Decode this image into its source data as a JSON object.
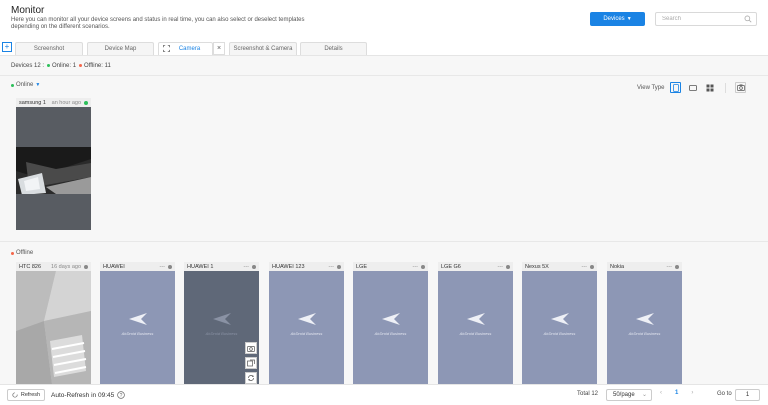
{
  "header": {
    "title": "Monitor",
    "description": "Here you can monitor all your device screens and status in real time, you can also select or deselect templates depending on the different scenarios.",
    "devices_button": "Devices",
    "search_placeholder": "Search"
  },
  "tabs": [
    {
      "label": "Screenshot",
      "active": false
    },
    {
      "label": "Device Map",
      "active": false
    },
    {
      "label": "Camera",
      "active": true
    },
    {
      "label": "Screenshot & Camera",
      "active": false
    },
    {
      "label": "Details",
      "active": false
    }
  ],
  "tab_close": "×",
  "stats": {
    "devices": "Devices 12 :",
    "online": "Online: 1",
    "offline": "Offline: 11"
  },
  "online_section": {
    "label": "Online",
    "view_type_label": "View Type",
    "devices": [
      {
        "name": "samsung 1",
        "time": "an hour ago",
        "status": "online"
      }
    ]
  },
  "offline_section": {
    "label": "Offline",
    "devices": [
      {
        "name": "HTC 826",
        "time": "16 days ago",
        "status": "offline",
        "screen": "photo"
      },
      {
        "name": "HUAWEI",
        "time": "---",
        "status": "offline",
        "screen": "brand",
        "brand_text": "AirDroid Business"
      },
      {
        "name": "HUAWEI 1",
        "time": "---",
        "status": "offline",
        "screen": "brand-dark",
        "brand_text": "AirDroid Business"
      },
      {
        "name": "HUAWEI 123",
        "time": "---",
        "status": "offline",
        "screen": "brand",
        "brand_text": "AirDroid Business"
      },
      {
        "name": "LGE",
        "time": "---",
        "status": "offline",
        "screen": "brand",
        "brand_text": "AirDroid Business"
      },
      {
        "name": "LGE G6",
        "time": "---",
        "status": "offline",
        "screen": "brand",
        "brand_text": "AirDroid Business"
      },
      {
        "name": "Nexus 5X",
        "time": "---",
        "status": "offline",
        "screen": "brand",
        "brand_text": "AirDroid Business"
      },
      {
        "name": "Nokia",
        "time": "---",
        "status": "offline",
        "screen": "brand",
        "brand_text": "AirDroid Business"
      }
    ]
  },
  "footer": {
    "refresh_button": "Refresh",
    "auto_refresh": "Auto-Refresh in 09:45",
    "total": "Total 12",
    "per_page": "50/page",
    "current_page": "1",
    "goto_label": "Go to",
    "goto_value": "1"
  },
  "colors": {
    "accent": "#1a83e4",
    "online": "#2dbf5a",
    "offline_dot": "#f5664a",
    "brand_screen": "#8d97b5"
  }
}
